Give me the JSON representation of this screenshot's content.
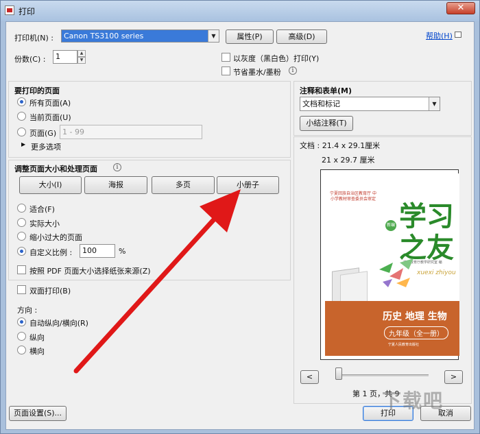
{
  "window": {
    "title": "打印",
    "close_glyph": "✕"
  },
  "printer": {
    "label": "打印机(N) :",
    "value": "Canon TS3100 series",
    "properties_button": "属性(P)",
    "advanced_button": "高级(D)",
    "help_link": "帮助(H)",
    "copies_label": "份数(C) :",
    "copies_value": "1",
    "grayscale_label": "以灰度（黑白色）打印(Y)",
    "save_ink_label": "节省墨水/墨粉"
  },
  "pages": {
    "title": "要打印的页面",
    "all": "所有页面(A)",
    "current": "当前页面(U)",
    "pages": "页面(G)",
    "range_placeholder": "1 - 99",
    "more": "更多选项"
  },
  "sizing": {
    "title": "调整页面大小和处理页面",
    "tabs": [
      "大小(I)",
      "海报",
      "多页",
      "小册子"
    ],
    "fit": "适合(F)",
    "actual": "实际大小",
    "shrink": "缩小过大的页面",
    "custom": "自定义比例 :",
    "custom_value": "100",
    "percent": "%",
    "pdf_source": "按照 PDF 页面大小选择纸张来源(Z)"
  },
  "duplex": {
    "label": "双面打印(B)",
    "orientation_label": "方向 :",
    "auto": "自动纵向/横向(R)",
    "portrait": "纵向",
    "landscape": "横向"
  },
  "comments": {
    "title": "注释和表单(M)",
    "value": "文档和标记",
    "summarize_button": "小结注释(T)"
  },
  "preview": {
    "doc_size": "文档 :  21.4 x 29.1厘米",
    "paper_size": "21 x 29.7 厘米",
    "page_info": "第 1 页，共 9",
    "prev": "<",
    "next": ">",
    "cover": {
      "publisher": "宁夏回族自治区教育厅 中小学教材审查委员会审定",
      "title_line1": "学习",
      "title_line2": "之友",
      "badge": "新编",
      "pinyin": "xuexi zhiyou",
      "editor": "宁夏教育厅教学研究室 编",
      "subjects": "历史 地理 生物",
      "grade": "九年级（全一册）",
      "press": "宁夏人民教育出版社"
    }
  },
  "footer": {
    "page_setup": "页面设置(S)...",
    "print": "打印",
    "cancel": "取消"
  },
  "watermark": "下载吧"
}
